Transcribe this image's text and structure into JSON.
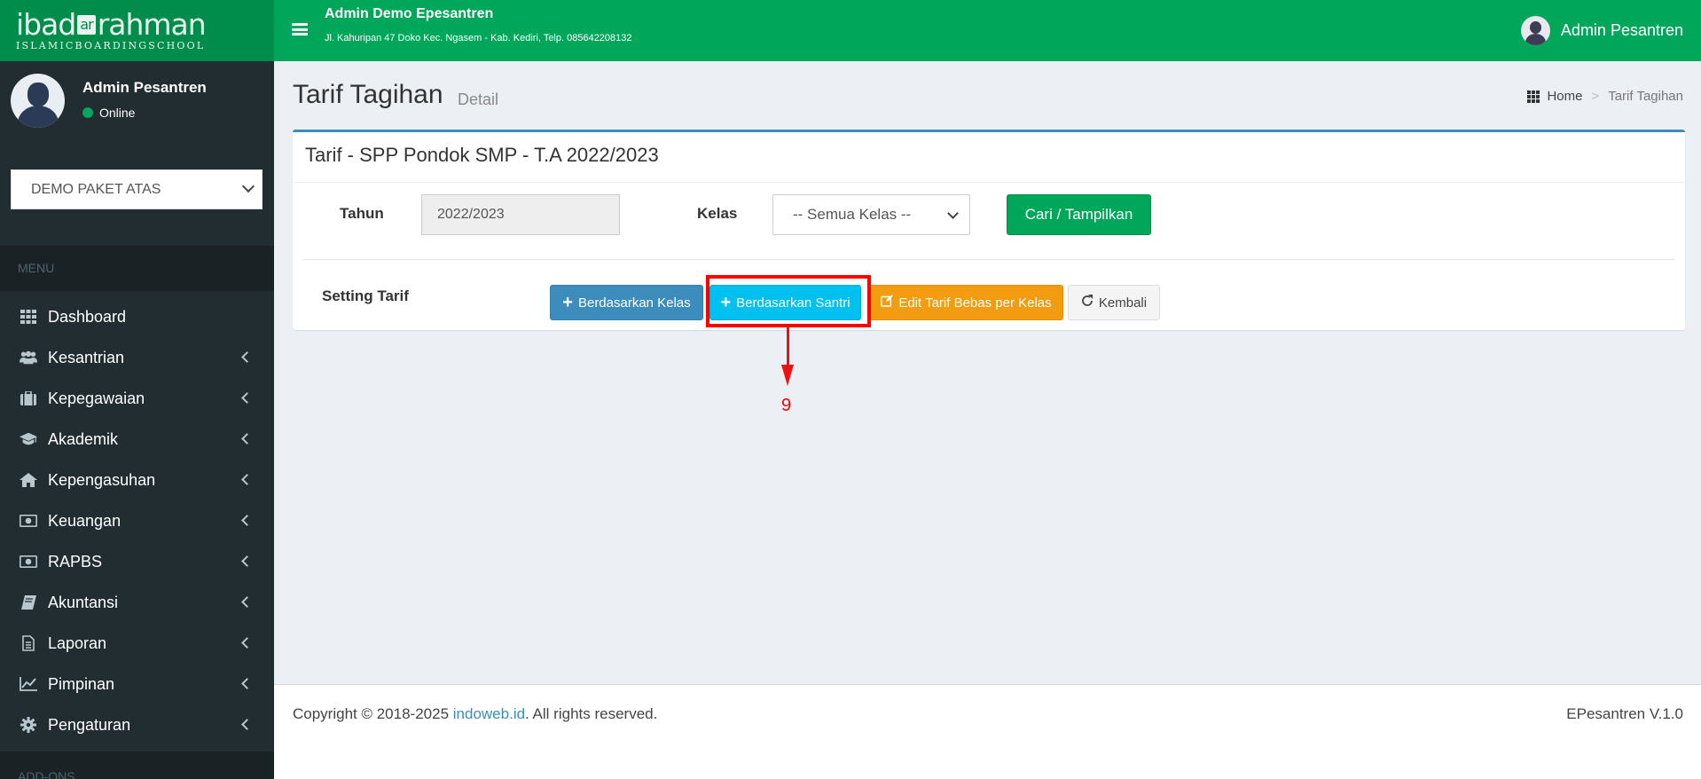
{
  "logo": {
    "brand_left": "ibad",
    "brand_mid": "ar",
    "brand_right": "rahman",
    "tagline": "ISLAMICBOARDINGSCHOOL"
  },
  "header": {
    "institution_name": "Admin Demo Epesantren",
    "institution_address": "Jl. Kahuripan 47 Doko Kec. Ngasem - Kab. Kediri, Telp. 085642208132",
    "user_name": "Admin Pesantren",
    "bg_color": "#00a65a"
  },
  "sidebar": {
    "user_name": "Admin Pesantren",
    "user_status": "Online",
    "school_select": "DEMO PAKET ATAS",
    "menu_header": "MENU",
    "items": [
      {
        "label": "Dashboard",
        "icon": "dashboard-icon"
      },
      {
        "label": "Kesantrian",
        "icon": "users-icon"
      },
      {
        "label": "Kepegawaian",
        "icon": "briefcase-icon"
      },
      {
        "label": "Akademik",
        "icon": "graduation-cap-icon"
      },
      {
        "label": "Kepengasuhan",
        "icon": "home-icon"
      },
      {
        "label": "Keuangan",
        "icon": "money-icon"
      },
      {
        "label": "RAPBS",
        "icon": "money-icon"
      },
      {
        "label": "Akuntansi",
        "icon": "book-icon"
      },
      {
        "label": "Laporan",
        "icon": "file-icon"
      },
      {
        "label": "Pimpinan",
        "icon": "line-chart-icon"
      },
      {
        "label": "Pengaturan",
        "icon": "gear-icon"
      }
    ],
    "addons_header": "ADD-ONS"
  },
  "page": {
    "title": "Tarif Tagihan",
    "subtitle": "Detail",
    "breadcrumb": {
      "home": "Home",
      "current": "Tarif Tagihan"
    }
  },
  "box": {
    "title": "Tarif - SPP Pondok SMP - T.A 2022/2023",
    "tahun_label": "Tahun",
    "tahun_value": "2022/2023",
    "kelas_label": "Kelas",
    "kelas_value": "-- Semua Kelas --",
    "cari_label": "Cari / Tampilkan",
    "setting_label": "Setting Tarif",
    "buttons": {
      "by_kelas": "Berdasarkan Kelas",
      "by_santri": "Berdasarkan Santri",
      "edit_bebas": "Edit Tarif Bebas per Kelas",
      "kembali": "Kembali"
    }
  },
  "annotation": {
    "number": "9",
    "color": "#ff0000"
  },
  "footer": {
    "copyright_prefix": "Copyright © 2018-2025",
    "link": "indoweb.id",
    "copyright_suffix": ". All rights reserved.",
    "version": "EPesantren V.1.0"
  }
}
